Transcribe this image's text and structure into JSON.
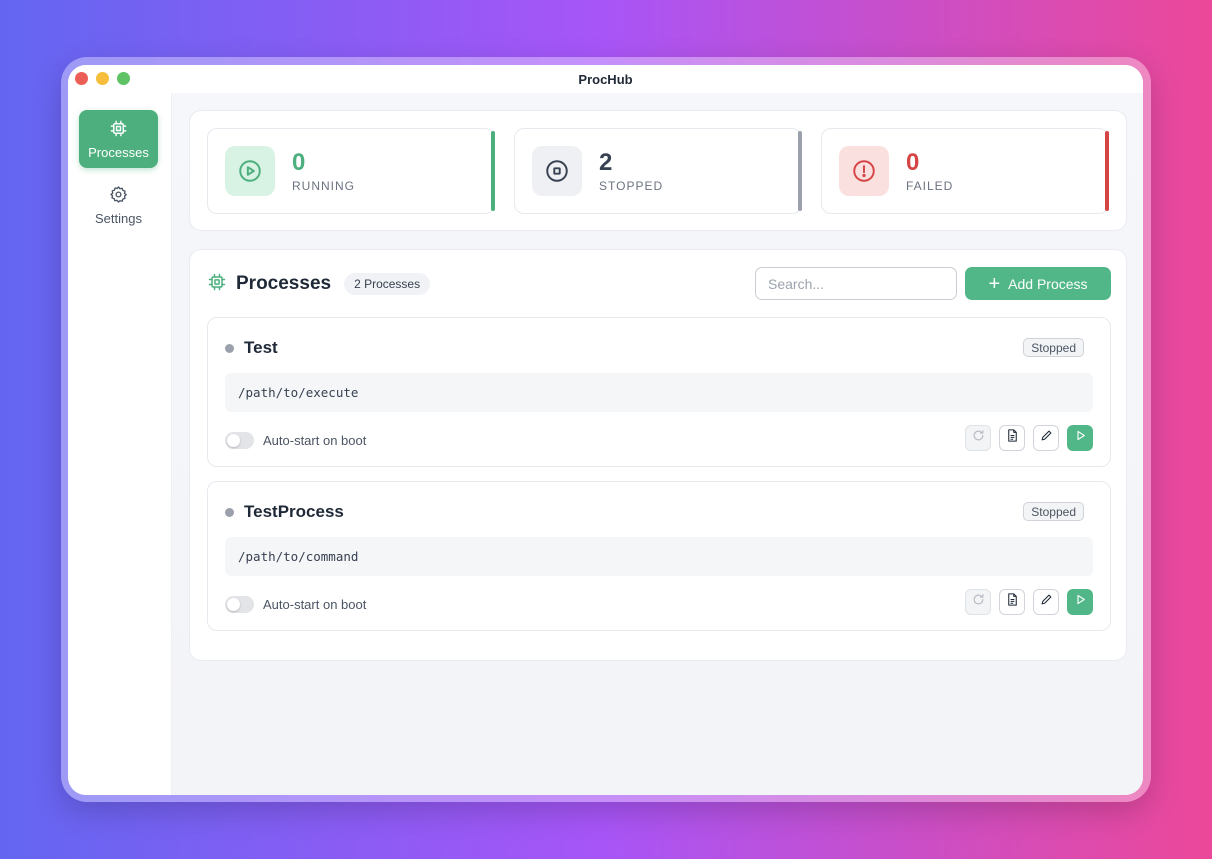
{
  "app": {
    "title": "ProcHub"
  },
  "sidebar": {
    "items": [
      {
        "label": "Processes",
        "icon": "cpu-icon",
        "active": true
      },
      {
        "label": "Settings",
        "icon": "gear-icon",
        "active": false
      }
    ]
  },
  "stats": [
    {
      "value": "0",
      "label": "RUNNING",
      "icon": "play-circle-icon",
      "color": "#4caf7d"
    },
    {
      "value": "2",
      "label": "STOPPED",
      "icon": "stop-circle-icon",
      "color": "#374151"
    },
    {
      "value": "0",
      "label": "FAILED",
      "icon": "alert-circle-icon",
      "color": "#d64545"
    }
  ],
  "processes_panel": {
    "title": "Processes",
    "count_label": "2 Processes",
    "search_placeholder": "Search...",
    "add_button_label": "Add Process"
  },
  "processes": [
    {
      "name": "Test",
      "status": "Stopped",
      "command": "/path/to/execute",
      "autostart_label": "Auto-start on boot",
      "autostart": false
    },
    {
      "name": "TestProcess",
      "status": "Stopped",
      "command": "/path/to/command",
      "autostart_label": "Auto-start on boot",
      "autostart": false
    }
  ],
  "colors": {
    "accent": "#52b788",
    "running": "#4caf7d",
    "stopped": "#9aa1ad",
    "failed": "#d64545"
  }
}
